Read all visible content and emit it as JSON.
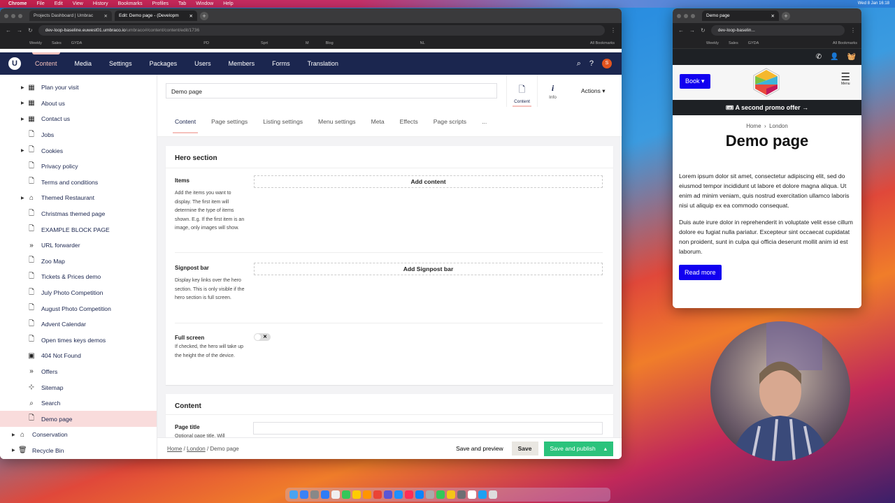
{
  "os": {
    "menubar": [
      "Chrome",
      "File",
      "Edit",
      "View",
      "History",
      "Bookmarks",
      "Profiles",
      "Tab",
      "Window",
      "Help"
    ],
    "clock": "Wed 8 Jan 16:18"
  },
  "main_browser": {
    "tabs": [
      {
        "title": "Projects Dashboard | Umbrac"
      },
      {
        "title": "Edit: Demo page - (Developm"
      }
    ],
    "url_host": "dev-loop-baseline.euwest01.umbraco.io",
    "url_path": "/umbraco#/content/content/edit/1736",
    "bookmarks": [
      "Weekly",
      "Sales",
      "GYDA",
      "PD",
      "Sprt",
      "M",
      "Blog",
      "NL",
      "All Bookmarks"
    ]
  },
  "umbraco": {
    "logo": "U",
    "sections": [
      "Content",
      "Media",
      "Settings",
      "Packages",
      "Users",
      "Members",
      "Forms",
      "Translation"
    ],
    "active_section": "Content",
    "avatar_initial": "S",
    "tree": [
      {
        "label": "Plan your visit",
        "icon": "grid-icon",
        "expand": true
      },
      {
        "label": "About us",
        "icon": "grid-icon",
        "expand": true
      },
      {
        "label": "Contact us",
        "icon": "grid-icon",
        "expand": true
      },
      {
        "label": "Jobs",
        "icon": "document-icon"
      },
      {
        "label": "Cookies",
        "icon": "document-icon",
        "expand": true
      },
      {
        "label": "Privacy policy",
        "icon": "document-icon"
      },
      {
        "label": "Terms and conditions",
        "icon": "document-icon"
      },
      {
        "label": "Themed Restaurant",
        "icon": "home-icon",
        "expand": true
      },
      {
        "label": "Christmas themed page",
        "icon": "document-icon"
      },
      {
        "label": "EXAMPLE BLOCK PAGE",
        "icon": "document-icon"
      },
      {
        "label": "URL forwarder",
        "icon": "double-chevron-icon"
      },
      {
        "label": "Zoo Map",
        "icon": "document-icon"
      },
      {
        "label": "Tickets & Prices demo",
        "icon": "document-icon"
      },
      {
        "label": "July Photo Competition",
        "icon": "document-icon"
      },
      {
        "label": "August Photo Competition",
        "icon": "document-icon"
      },
      {
        "label": "Advent Calendar",
        "icon": "document-icon"
      },
      {
        "label": "Open times keys demos",
        "icon": "document-icon"
      },
      {
        "label": "404 Not Found",
        "icon": "window-icon"
      },
      {
        "label": "Offers",
        "icon": "double-chevron-icon"
      },
      {
        "label": "Sitemap",
        "icon": "sitemap-icon"
      },
      {
        "label": "Search",
        "icon": "search-icon"
      },
      {
        "label": "Demo page",
        "icon": "document-icon",
        "selected": true
      },
      {
        "label": "Conservation",
        "icon": "home-icon",
        "expand": true,
        "root": true
      },
      {
        "label": "Recycle Bin",
        "icon": "trash-icon",
        "expand": true,
        "root": true
      }
    ],
    "editor": {
      "name": "Demo page",
      "apps": [
        {
          "label": "Content",
          "icon": "document-icon"
        },
        {
          "label": "Info",
          "icon": "info-icon"
        }
      ],
      "actions": "Actions",
      "tabs": [
        "Content",
        "Page settings",
        "Listing settings",
        "Menu settings",
        "Meta",
        "Effects",
        "Page scripts",
        "..."
      ],
      "hero": {
        "title": "Hero section",
        "items_label": "Items",
        "items_desc": "Add the items you want to display. The first item will determine the type of items shown. E.g. If the first item is an image, only images will show.",
        "items_button": "Add content",
        "signpost_label": "Signpost bar",
        "signpost_desc": "Display key links over the hero section. This is only visible if the hero section is full screen.",
        "signpost_button": "Add Signpost bar",
        "fullscreen_label": "Full screen",
        "fullscreen_desc": "If checked, the hero will take up the height the of the device.",
        "fullscreen_on": false
      },
      "content": {
        "title": "Content",
        "page_title_label": "Page title",
        "page_title_desc": "Optional page title. Will",
        "page_title_value": ""
      }
    },
    "footer": {
      "breadcrumb": [
        "Home",
        "London",
        "Demo page"
      ],
      "save_preview": "Save and preview",
      "save": "Save",
      "publish": "Save and publish"
    }
  },
  "preview_browser": {
    "tab": "Demo page",
    "url": "dev-loop-baselin...",
    "bookmarks": [
      "Weekly",
      "Sales",
      "GYDA",
      "All Bookmarks"
    ],
    "site": {
      "book": "Book",
      "menu": "Menu",
      "promo": "A second promo offer →",
      "breadcrumb": [
        "Home",
        "London"
      ],
      "title": "Demo page",
      "paragraphs": [
        "Lorem ipsum dolor sit amet, consectetur adipiscing elit, sed do eiusmod tempor incididunt ut labore et dolore magna aliqua. Ut enim ad minim veniam, quis nostrud exercitation ullamco laboris nisi ut aliquip ex ea commodo consequat.",
        "Duis aute irure dolor in reprehenderit in voluptate velit esse cillum dolore eu fugiat nulla pariatur. Excepteur sint occaecat cupidatat non proident, sunt in culpa qui officia deserunt mollit anim id est laborum."
      ],
      "read_more": "Read more"
    }
  },
  "colors": {
    "umbraco_header": "#1b264f",
    "accent_pink": "#f5c1bc",
    "publish_green": "#2bc37c",
    "site_blue": "#1100f0"
  }
}
